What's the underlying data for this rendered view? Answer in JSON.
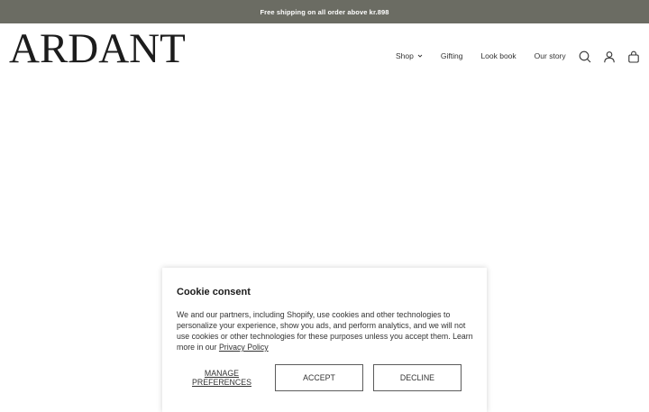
{
  "announcement": {
    "text": "Free shipping on all order above kr.898"
  },
  "header": {
    "logo": "ARDANT",
    "nav": [
      {
        "label": "Shop",
        "has_dropdown": true
      },
      {
        "label": "Gifting"
      },
      {
        "label": "Look book"
      },
      {
        "label": "Our story"
      }
    ],
    "icons": [
      "search-icon",
      "account-icon",
      "cart-icon"
    ]
  },
  "cookie_consent": {
    "title": "Cookie consent",
    "body": "We and our partners, including Shopify, use cookies and other technologies to personalize your experience, show you ads, and perform analytics, and we will not use cookies or other technologies for these purposes unless you accept them. Learn more in our ",
    "privacy_link": "Privacy Policy",
    "manage_label": "MANAGE PREFERENCES",
    "accept_label": "ACCEPT",
    "decline_label": "DECLINE"
  },
  "colors": {
    "announcement_bg": "#6b6c63",
    "text": "#222222",
    "button_border": "#5c5c5c"
  }
}
